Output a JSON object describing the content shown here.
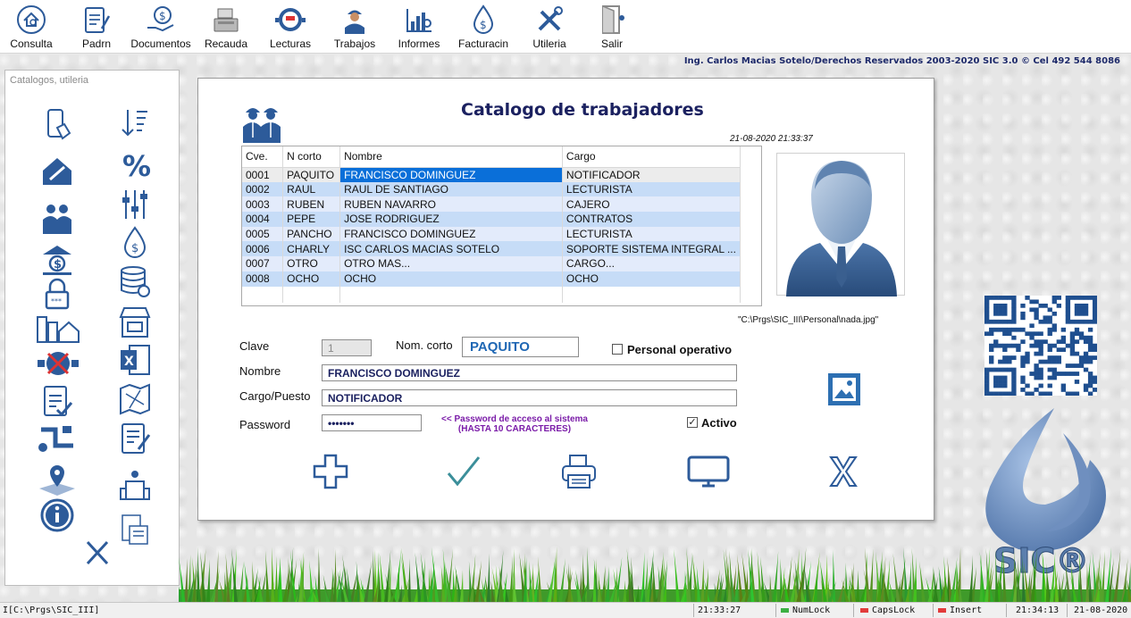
{
  "toolbar": {
    "items": [
      {
        "label": "Consulta",
        "icon": "house-search-icon"
      },
      {
        "label": "Padrn",
        "icon": "clipboard-edit-icon"
      },
      {
        "label": "Documentos",
        "icon": "money-hand-icon"
      },
      {
        "label": "Recauda",
        "icon": "cash-register-icon"
      },
      {
        "label": "Lecturas",
        "icon": "water-meter-icon"
      },
      {
        "label": "Trabajos",
        "icon": "worker-icon"
      },
      {
        "label": "Informes",
        "icon": "chart-report-icon"
      },
      {
        "label": "Facturacin",
        "icon": "water-drop-dollar-icon"
      },
      {
        "label": "Utileria",
        "icon": "tools-icon"
      },
      {
        "label": "Salir",
        "icon": "exit-door-icon"
      }
    ]
  },
  "copyright": "Ing. Carlos Macias Sotelo/Derechos Reservados 2003-2020 SIC 3.0 ©  Cel 492 544 8086",
  "left_panel": {
    "title": "Catalogos, utileria"
  },
  "form": {
    "title": "Catalogo de trabajadores",
    "datetime": "21-08-2020 21:33:37",
    "grid": {
      "columns": [
        "Cve.",
        "N corto",
        "Nombre",
        "Cargo"
      ],
      "rows": [
        {
          "cve": "0001",
          "corto": "PAQUITO",
          "nombre": "FRANCISCO DOMINGUEZ",
          "cargo": "NOTIFICADOR"
        },
        {
          "cve": "0002",
          "corto": "RAUL",
          "nombre": "RAUL DE SANTIAGO",
          "cargo": "LECTURISTA"
        },
        {
          "cve": "0003",
          "corto": "RUBEN",
          "nombre": "RUBEN NAVARRO",
          "cargo": "CAJERO"
        },
        {
          "cve": "0004",
          "corto": "PEPE",
          "nombre": "JOSE RODRIGUEZ",
          "cargo": "CONTRATOS"
        },
        {
          "cve": "0005",
          "corto": "PANCHO",
          "nombre": "FRANCISCO DOMINGUEZ",
          "cargo": "LECTURISTA"
        },
        {
          "cve": "0006",
          "corto": "CHARLY",
          "nombre": "ISC CARLOS MACIAS SOTELO",
          "cargo": "SOPORTE SISTEMA INTEGRAL ..."
        },
        {
          "cve": "0007",
          "corto": "OTRO",
          "nombre": "OTRO MAS...",
          "cargo": "CARGO..."
        },
        {
          "cve": "0008",
          "corto": "OCHO",
          "nombre": "OCHO",
          "cargo": "OCHO"
        }
      ]
    },
    "photo_path": "\"C:\\Prgs\\SIC_III\\Personal\\nada.jpg\"",
    "fields": {
      "clave_label": "Clave",
      "clave_value": "1",
      "nom_corto_label": "Nom. corto",
      "nom_corto_value": "PAQUITO",
      "personal_operativo_label": "Personal operativo",
      "nombre_label": "Nombre",
      "nombre_value": "FRANCISCO DOMINGUEZ",
      "cargo_label": "Cargo/Puesto",
      "cargo_value": "NOTIFICADOR",
      "password_label": "Password",
      "password_value": "•••••••",
      "password_note_1": "<< Password de acceso al sistema",
      "password_note_2": "(HASTA 10 CARACTERES)",
      "activo_label": "Activo",
      "activo_mark": "✓"
    }
  },
  "qr_code": "qr-code",
  "logo_text": "SIC®",
  "statusbar": {
    "path": "I[C:\\Prgs\\SIC_III]",
    "time1": "21:33:27",
    "numlock": "NumLock",
    "capslock": "CapsLock",
    "insert": "Insert",
    "time2": "21:34:13",
    "date": "21-08-2020"
  },
  "colors": {
    "accent": "#1b2160",
    "icon_blue": "#2d5b9a",
    "row_alt": "#c6dcf7",
    "selection": "#0a6fd9",
    "teal_check": "#3b8f9a"
  }
}
